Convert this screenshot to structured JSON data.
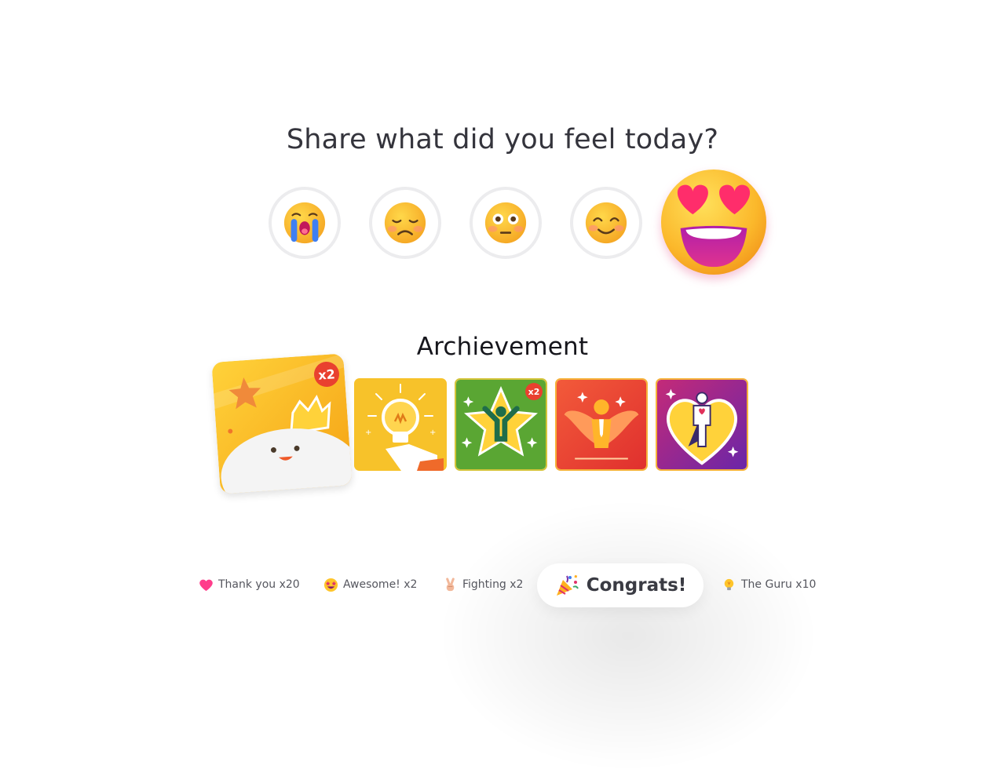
{
  "mood": {
    "title": "Share what did you feel today?",
    "options": [
      {
        "icon": "loudly-crying-face-icon",
        "selected": false
      },
      {
        "icon": "pensive-face-icon",
        "selected": false
      },
      {
        "icon": "flushed-face-icon",
        "selected": false
      },
      {
        "icon": "smiling-face-icon",
        "selected": false
      },
      {
        "icon": "heart-eyes-face-icon",
        "selected": true
      }
    ]
  },
  "achievement": {
    "title": "Archievement",
    "badges": [
      {
        "icon": "crown-mascot-badge-icon",
        "count": "x2",
        "featured": true
      },
      {
        "icon": "lightbulb-hand-badge-icon",
        "count": ""
      },
      {
        "icon": "star-person-badge-icon",
        "count": "x2"
      },
      {
        "icon": "winged-person-badge-icon",
        "count": ""
      },
      {
        "icon": "heart-hero-badge-icon",
        "count": ""
      }
    ]
  },
  "reactions": [
    {
      "icon": "pink-heart-icon",
      "label": "Thank you x20"
    },
    {
      "icon": "star-struck-face-icon",
      "label": "Awesome! x2"
    },
    {
      "icon": "victory-hand-icon",
      "label": "Fighting x2"
    },
    {
      "icon": "party-popper-icon",
      "label": "Congrats!",
      "highlighted": true
    },
    {
      "icon": "light-bulb-icon",
      "label": "The Guru x10"
    }
  ],
  "colors": {
    "accent_red": "#e9402f",
    "badge_yellow": "#f7c22a",
    "badge_green": "#5aa633",
    "badge_red": "#ef4a35",
    "badge_purple": "#7b2fa8",
    "text_dark": "#34343c"
  }
}
